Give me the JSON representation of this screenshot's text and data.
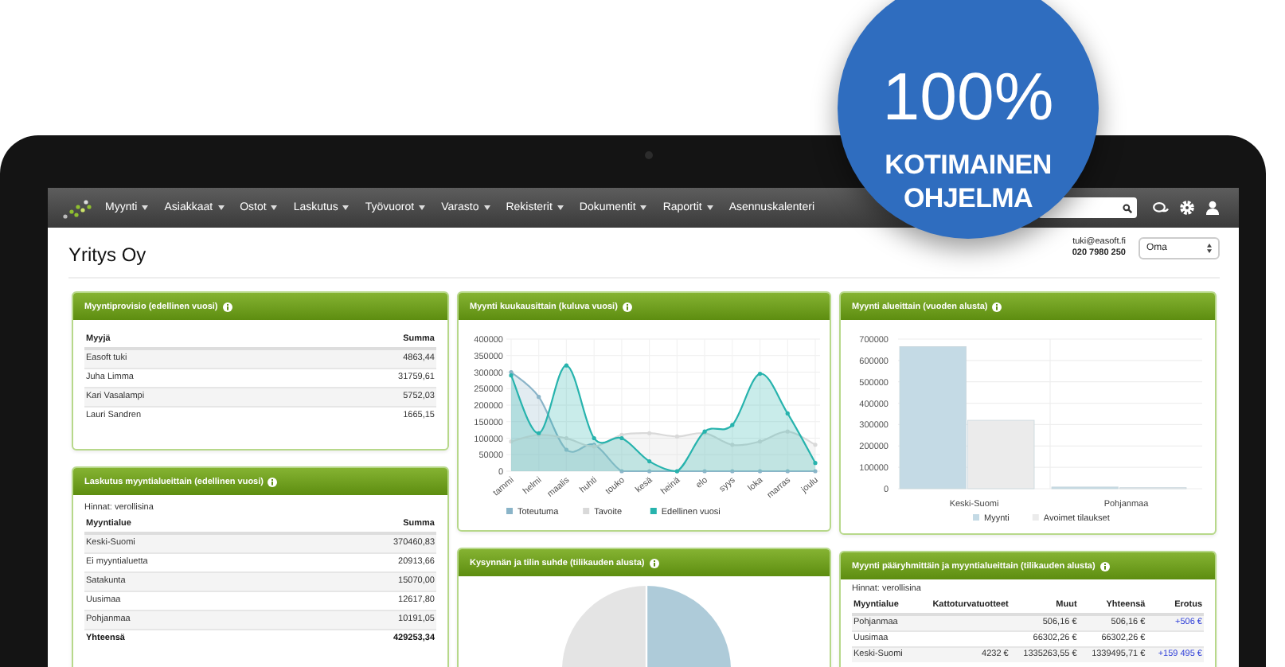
{
  "badge": {
    "value": "100%",
    "line_1": "KOTIMAINEN",
    "line_2": "OHJELMA"
  },
  "nav": {
    "items": [
      {
        "label": "Myynti",
        "dropdown": true
      },
      {
        "label": "Asiakkaat",
        "dropdown": true
      },
      {
        "label": "Ostot",
        "dropdown": true
      },
      {
        "label": "Laskutus",
        "dropdown": true
      },
      {
        "label": "Työvuorot",
        "dropdown": true
      },
      {
        "label": "Varasto",
        "dropdown": true
      },
      {
        "label": "Rekisterit",
        "dropdown": true
      },
      {
        "label": "Dokumentit",
        "dropdown": true
      },
      {
        "label": "Raportit",
        "dropdown": true
      },
      {
        "label": "Asennuskalenteri",
        "dropdown": false
      }
    ]
  },
  "header": {
    "title": "Yritys Oy",
    "email": "tuki@easoft.fi",
    "phone": "020 7980 250",
    "view_select": "Oma"
  },
  "columns": [
    {
      "panels": [
        {
          "kind": "table",
          "title": "Myyntiprovisio (edellinen vuosi)",
          "columns": [
            {
              "label": "Myyjä",
              "signed": false
            },
            {
              "label": "Summa",
              "signed": false
            }
          ],
          "rows": [
            {
              "cells": [
                "Easoft tuki",
                "4863,44"
              ],
              "total": false
            },
            {
              "cells": [
                "Juha Limma",
                "31759,61"
              ],
              "total": false
            },
            {
              "cells": [
                "Kari Vasalampi",
                "5752,03"
              ],
              "total": false
            },
            {
              "cells": [
                "Lauri Sandren",
                "1665,15"
              ],
              "total": false
            }
          ]
        },
        {
          "kind": "table",
          "title": "Laskutus myyntialueittain (edellinen vuosi)",
          "note": "Hinnat: verollisina",
          "columns": [
            {
              "label": "Myyntialue",
              "signed": false
            },
            {
              "label": "Summa",
              "signed": false
            }
          ],
          "rows": [
            {
              "cells": [
                "Keski-Suomi",
                "370460,83"
              ],
              "total": false
            },
            {
              "cells": [
                "Ei myyntialuetta",
                "20913,66"
              ],
              "total": false
            },
            {
              "cells": [
                "Satakunta",
                "15070,00"
              ],
              "total": false
            },
            {
              "cells": [
                "Uusimaa",
                "12617,80"
              ],
              "total": false
            },
            {
              "cells": [
                "Pohjanmaa",
                "10191,05"
              ],
              "total": false
            },
            {
              "cells": [
                "Yhteensä",
                "429253,34"
              ],
              "total": true
            }
          ]
        }
      ]
    },
    {
      "panels": [
        {
          "kind": "chart",
          "title": "Myynti kuukausittain (kuluva vuosi)",
          "chart_data": {
            "type": "area",
            "grid": true,
            "legend": "bottom",
            "categories": [
              "tammi",
              "helmi",
              "maalis",
              "huhti",
              "touko",
              "kesä",
              "heinä",
              "elo",
              "syys",
              "loka",
              "marras",
              "joulu"
            ],
            "ylim": [
              0,
              400000
            ],
            "yticks": [
              0,
              50000,
              100000,
              150000,
              200000,
              250000,
              300000,
              350000,
              400000
            ],
            "series": [
              {
                "name": "Toteutuma",
                "color": "#8ab4c8",
                "values": [
                  300000,
                  225000,
                  65000,
                  80000,
                  0,
                  0,
                  0,
                  0,
                  0,
                  0,
                  0,
                  0
                ]
              },
              {
                "name": "Tavoite",
                "color": "#d9d9d9",
                "values": [
                  90000,
                  110000,
                  100000,
                  75000,
                  110000,
                  115000,
                  105000,
                  115000,
                  80000,
                  90000,
                  120000,
                  80000
                ]
              },
              {
                "name": "Edellinen vuosi",
                "color": "#27b3ad",
                "values": [
                  290000,
                  115000,
                  320000,
                  100000,
                  100000,
                  30000,
                  0,
                  120000,
                  140000,
                  295000,
                  175000,
                  25000
                ]
              }
            ]
          }
        },
        {
          "kind": "pie",
          "title": "Kysynnän ja tilin suhde (tilikauden alusta)"
        }
      ]
    },
    {
      "panels": [
        {
          "kind": "chart",
          "title": "Myynti alueittain (vuoden alusta)",
          "chart_data": {
            "type": "bar",
            "grid": true,
            "legend": "bottom",
            "categories": [
              "Keski-Suomi",
              "Pohjanmaa"
            ],
            "ylim": [
              0,
              700000
            ],
            "yticks": [
              0,
              100000,
              200000,
              300000,
              400000,
              500000,
              600000,
              700000
            ],
            "series": [
              {
                "name": "Myynti",
                "color": "#c4dae5",
                "values": [
                  665000,
                  8000
                ]
              },
              {
                "name": "Avoimet tilaukset",
                "color": "#ebebeb",
                "values": [
                  320000,
                  5000
                ]
              }
            ]
          }
        },
        {
          "kind": "table",
          "title": "Myynti pääryhmittäin ja myyntialueittain (tilikauden alusta)",
          "note": "Hinnat: verollisina",
          "columns": [
            {
              "label": "Myyntialue",
              "signed": false
            },
            {
              "label": "Kattoturvatuotteet",
              "signed": false
            },
            {
              "label": "Muut",
              "signed": false
            },
            {
              "label": "Yhteensä",
              "signed": false
            },
            {
              "label": "Erotus",
              "signed": true
            }
          ],
          "rows": [
            {
              "cells": [
                "Pohjanmaa",
                null,
                "506,16 €",
                "506,16 €",
                "+506 €"
              ],
              "total": false
            },
            {
              "cells": [
                "Uusimaa",
                null,
                "66302,26 €",
                "66302,26 €",
                null
              ],
              "total": false
            },
            {
              "cells": [
                "Keski-Suomi",
                "4232 €",
                "1335263,55 €",
                "1339495,71 €",
                "+159 495 €"
              ],
              "total": false
            }
          ]
        }
      ]
    }
  ]
}
